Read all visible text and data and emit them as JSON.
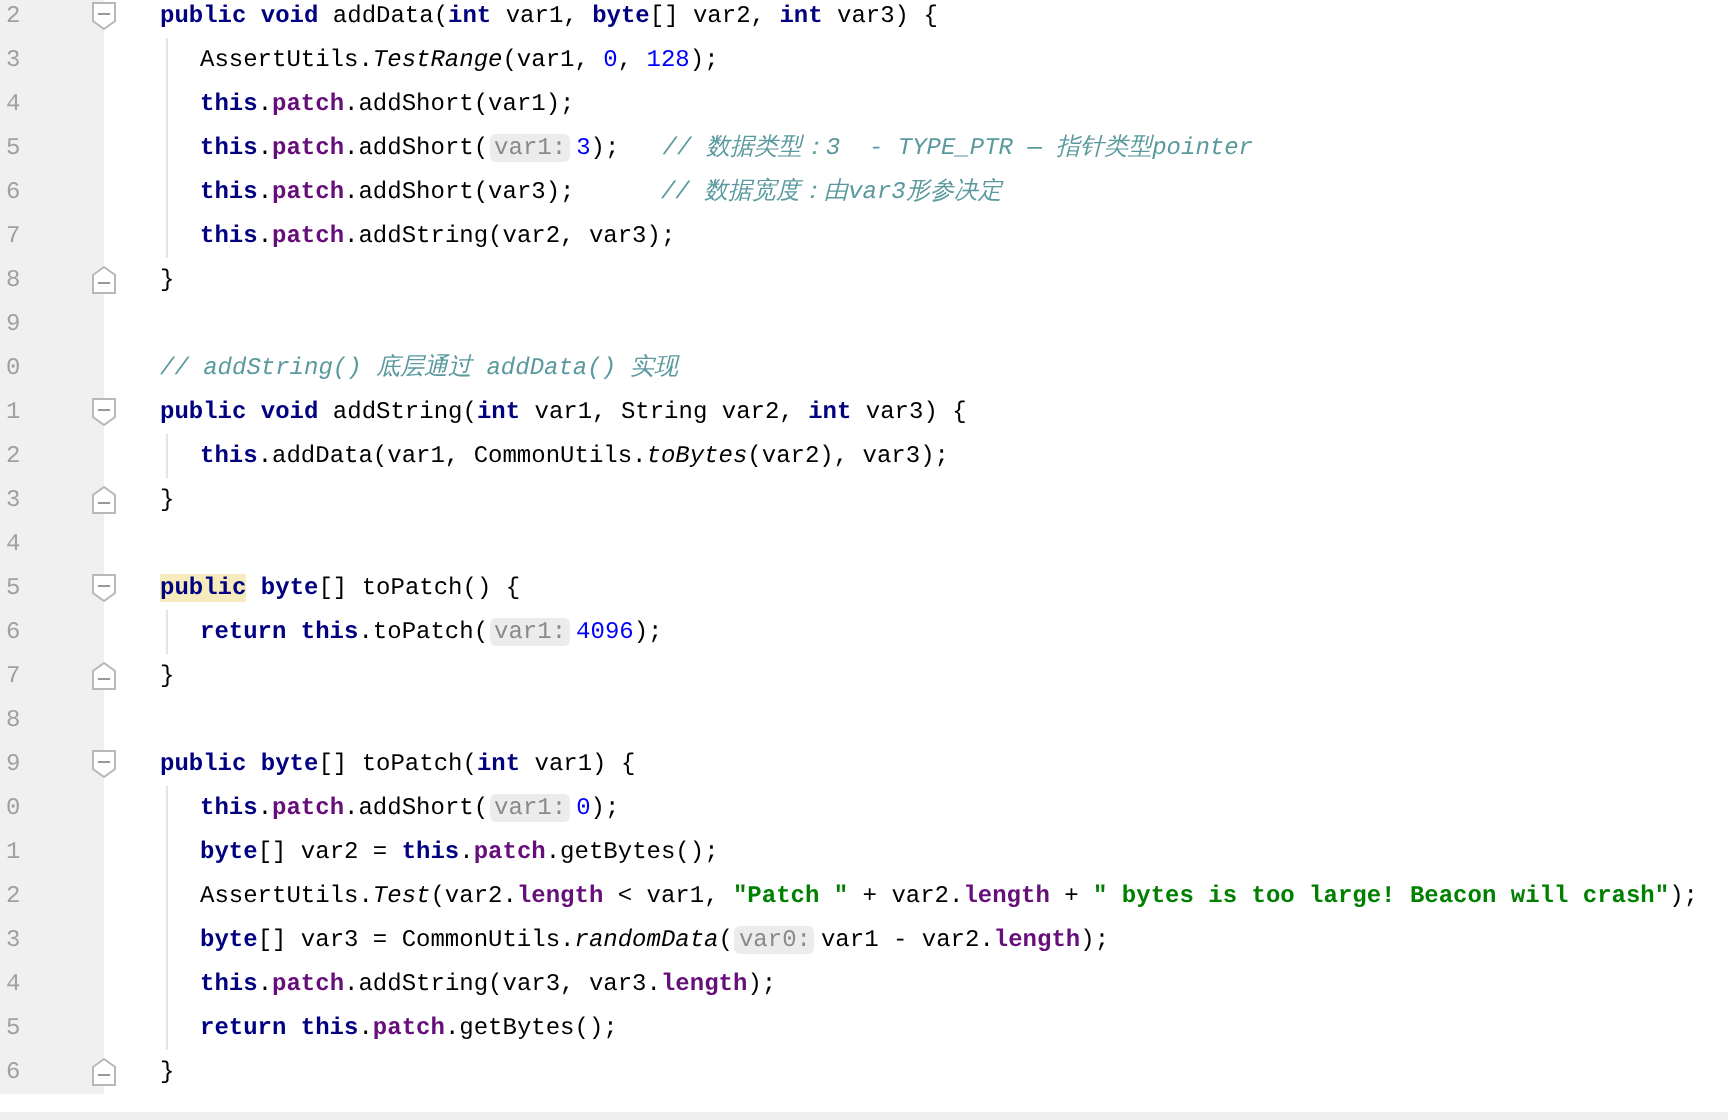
{
  "editor": {
    "lines": [
      {
        "number": "2",
        "kind": "opener",
        "tokens": [
          {
            "kind": "keyword",
            "text": "public void"
          },
          {
            "kind": "plain",
            "text": " addData("
          },
          {
            "kind": "keyword",
            "text": "int"
          },
          {
            "kind": "plain",
            "text": " var1, "
          },
          {
            "kind": "keyword",
            "text": "byte"
          },
          {
            "kind": "plain",
            "text": "[] var2, "
          },
          {
            "kind": "keyword",
            "text": "int"
          },
          {
            "kind": "plain",
            "text": " var3) {"
          }
        ],
        "children": [
          {
            "number": "3",
            "kind": "line",
            "tokens": [
              {
                "kind": "plain",
                "text": "AssertUtils."
              },
              {
                "kind": "static",
                "text": "TestRange"
              },
              {
                "kind": "plain",
                "text": "(var1, "
              },
              {
                "kind": "number",
                "text": "0"
              },
              {
                "kind": "plain",
                "text": ", "
              },
              {
                "kind": "number",
                "text": "128"
              },
              {
                "kind": "plain",
                "text": ");"
              }
            ]
          },
          {
            "number": "4",
            "kind": "line",
            "tokens": [
              {
                "kind": "keyword",
                "text": "this"
              },
              {
                "kind": "plain",
                "text": "."
              },
              {
                "kind": "field",
                "text": "patch"
              },
              {
                "kind": "plain",
                "text": ".addShort(var1);"
              }
            ]
          },
          {
            "number": "5",
            "kind": "line",
            "tokens": [
              {
                "kind": "keyword",
                "text": "this"
              },
              {
                "kind": "plain",
                "text": "."
              },
              {
                "kind": "field",
                "text": "patch"
              },
              {
                "kind": "plain",
                "text": ".addShort("
              },
              {
                "kind": "hint",
                "text": "var1:"
              },
              {
                "kind": "number",
                "text": "3"
              },
              {
                "kind": "plain",
                "text": ");   "
              },
              {
                "kind": "comment",
                "text": "// 数据类型：3  - TYPE_PTR — 指针类型pointer"
              }
            ]
          },
          {
            "number": "6",
            "kind": "line",
            "tokens": [
              {
                "kind": "keyword",
                "text": "this"
              },
              {
                "kind": "plain",
                "text": "."
              },
              {
                "kind": "field",
                "text": "patch"
              },
              {
                "kind": "plain",
                "text": ".addShort(var3);      "
              },
              {
                "kind": "comment",
                "text": "// 数据宽度：由var3形参决定"
              }
            ]
          },
          {
            "number": "7",
            "kind": "line",
            "tokens": [
              {
                "kind": "keyword",
                "text": "this"
              },
              {
                "kind": "plain",
                "text": "."
              },
              {
                "kind": "field",
                "text": "patch"
              },
              {
                "kind": "plain",
                "text": ".addString(var2, var3);"
              }
            ]
          }
        ]
      },
      {
        "number": "8",
        "kind": "closer",
        "tokens": [
          {
            "kind": "plain",
            "text": "}"
          }
        ]
      },
      {
        "number": "9",
        "kind": "line"
      },
      {
        "number": "0",
        "kind": "line",
        "tokens": [
          {
            "kind": "comment",
            "text": "// addString() 底层通过 addData() 实现"
          }
        ]
      },
      {
        "number": "1",
        "kind": "opener",
        "tokens": [
          {
            "kind": "keyword",
            "text": "public void"
          },
          {
            "kind": "plain",
            "text": " addString("
          },
          {
            "kind": "keyword",
            "text": "int"
          },
          {
            "kind": "plain",
            "text": " var1, String var2, "
          },
          {
            "kind": "keyword",
            "text": "int"
          },
          {
            "kind": "plain",
            "text": " var3) {"
          }
        ],
        "children": [
          {
            "number": "2",
            "kind": "line",
            "tokens": [
              {
                "kind": "keyword",
                "text": "this"
              },
              {
                "kind": "plain",
                "text": ".addData(var1, CommonUtils."
              },
              {
                "kind": "static",
                "text": "toBytes"
              },
              {
                "kind": "plain",
                "text": "(var2), var3);"
              }
            ]
          }
        ]
      },
      {
        "number": "3",
        "kind": "closer",
        "tokens": [
          {
            "kind": "plain",
            "text": "}"
          }
        ]
      },
      {
        "number": "4",
        "kind": "line"
      },
      {
        "number": "5",
        "kind": "opener",
        "tokens": [
          {
            "kind": "marked",
            "text": "public"
          },
          {
            "kind": "keyword",
            "text": " byte"
          },
          {
            "kind": "plain",
            "text": "[] toPatch() {"
          }
        ],
        "children": [
          {
            "number": "6",
            "kind": "line",
            "tokens": [
              {
                "kind": "keyword",
                "text": "return this"
              },
              {
                "kind": "plain",
                "text": ".toPatch("
              },
              {
                "kind": "hint",
                "text": "var1:"
              },
              {
                "kind": "number",
                "text": "4096"
              },
              {
                "kind": "plain",
                "text": ");"
              }
            ]
          }
        ]
      },
      {
        "number": "7",
        "kind": "closer",
        "tokens": [
          {
            "kind": "plain",
            "text": "}"
          }
        ]
      },
      {
        "number": "8",
        "kind": "line"
      },
      {
        "number": "9",
        "kind": "opener",
        "tokens": [
          {
            "kind": "keyword",
            "text": "public byte"
          },
          {
            "kind": "plain",
            "text": "[] toPatch("
          },
          {
            "kind": "keyword",
            "text": "int"
          },
          {
            "kind": "plain",
            "text": " var1) {"
          }
        ],
        "children": [
          {
            "number": "0",
            "kind": "line",
            "tokens": [
              {
                "kind": "keyword",
                "text": "this"
              },
              {
                "kind": "plain",
                "text": "."
              },
              {
                "kind": "field",
                "text": "patch"
              },
              {
                "kind": "plain",
                "text": ".addShort("
              },
              {
                "kind": "hint",
                "text": "var1:"
              },
              {
                "kind": "number",
                "text": "0"
              },
              {
                "kind": "plain",
                "text": ");"
              }
            ]
          },
          {
            "number": "1",
            "kind": "line",
            "tokens": [
              {
                "kind": "keyword",
                "text": "byte"
              },
              {
                "kind": "plain",
                "text": "[] var2 = "
              },
              {
                "kind": "keyword",
                "text": "this"
              },
              {
                "kind": "plain",
                "text": "."
              },
              {
                "kind": "field",
                "text": "patch"
              },
              {
                "kind": "plain",
                "text": ".getBytes();"
              }
            ]
          },
          {
            "number": "2",
            "kind": "line",
            "tokens": [
              {
                "kind": "plain",
                "text": "AssertUtils."
              },
              {
                "kind": "static",
                "text": "Test"
              },
              {
                "kind": "plain",
                "text": "(var2."
              },
              {
                "kind": "field",
                "text": "length"
              },
              {
                "kind": "plain",
                "text": " < var1, "
              },
              {
                "kind": "string",
                "text": "\"Patch \""
              },
              {
                "kind": "plain",
                "text": " + var2."
              },
              {
                "kind": "field",
                "text": "length"
              },
              {
                "kind": "plain",
                "text": " + "
              },
              {
                "kind": "string",
                "text": "\" bytes is too large! Beacon will crash\""
              },
              {
                "kind": "plain",
                "text": ");"
              }
            ]
          },
          {
            "number": "3",
            "kind": "line",
            "tokens": [
              {
                "kind": "keyword",
                "text": "byte"
              },
              {
                "kind": "plain",
                "text": "[] var3 = CommonUtils."
              },
              {
                "kind": "static",
                "text": "randomData"
              },
              {
                "kind": "plain",
                "text": "("
              },
              {
                "kind": "hint",
                "text": "var0:"
              },
              {
                "kind": "plain",
                "text": "var1 - var2."
              },
              {
                "kind": "field",
                "text": "length"
              },
              {
                "kind": "plain",
                "text": ");"
              }
            ]
          },
          {
            "number": "4",
            "kind": "line",
            "tokens": [
              {
                "kind": "keyword",
                "text": "this"
              },
              {
                "kind": "plain",
                "text": "."
              },
              {
                "kind": "field",
                "text": "patch"
              },
              {
                "kind": "plain",
                "text": ".addString(var3, var3."
              },
              {
                "kind": "field",
                "text": "length"
              },
              {
                "kind": "plain",
                "text": ");"
              }
            ]
          },
          {
            "number": "5",
            "kind": "line",
            "tokens": [
              {
                "kind": "keyword",
                "text": "return this"
              },
              {
                "kind": "plain",
                "text": "."
              },
              {
                "kind": "field",
                "text": "patch"
              },
              {
                "kind": "plain",
                "text": ".getBytes();"
              }
            ]
          }
        ]
      },
      {
        "number": "6",
        "kind": "closer",
        "tokens": [
          {
            "kind": "plain",
            "text": "}"
          }
        ]
      }
    ]
  }
}
